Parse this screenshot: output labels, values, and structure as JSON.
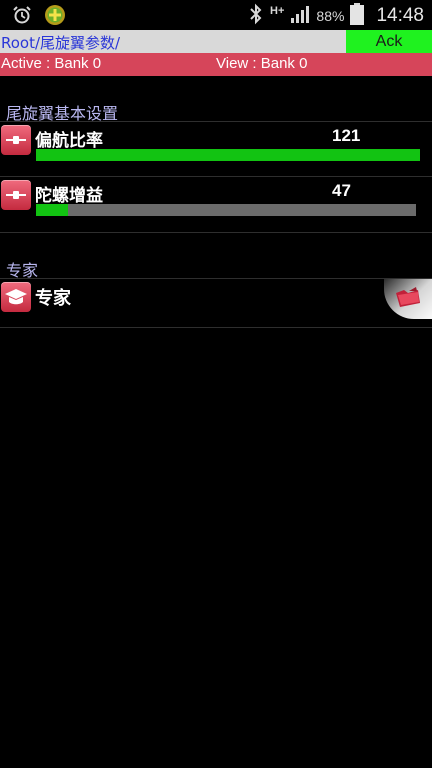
{
  "status_bar": {
    "battery_text": "88%",
    "time": "14:48",
    "network_label": "H+"
  },
  "path": {
    "text": "Root/尾旋翼参数/",
    "ack_label": "Ack"
  },
  "bank": {
    "active_text": "Active : Bank 0",
    "view_text": "View : Bank 0"
  },
  "sections": {
    "tail_basic": {
      "title": "尾旋翼基本设置",
      "items": [
        {
          "label": "偏航比率",
          "value": "121",
          "fraction": 1.0
        },
        {
          "label": "陀螺增益",
          "value": "47",
          "fraction": 0.085
        }
      ]
    },
    "expert": {
      "title": "专家",
      "item_label": "专家"
    }
  },
  "colors": {
    "accent_green": "#1ff21f",
    "bank_red": "#d6455a",
    "bar_fill": "#12c312",
    "bar_track": "#6b6b6b",
    "section_title": "#b9b7f0",
    "path_text": "#2a37d8"
  },
  "icons": {
    "status_left": [
      "alarm-icon",
      "app-notification-icon"
    ],
    "status_right": [
      "bluetooth-icon",
      "signal-icon",
      "battery-icon"
    ],
    "items": [
      "slider-icon",
      "slider-icon",
      "graduation-cap-icon"
    ],
    "expert_action": "folder-icon"
  }
}
